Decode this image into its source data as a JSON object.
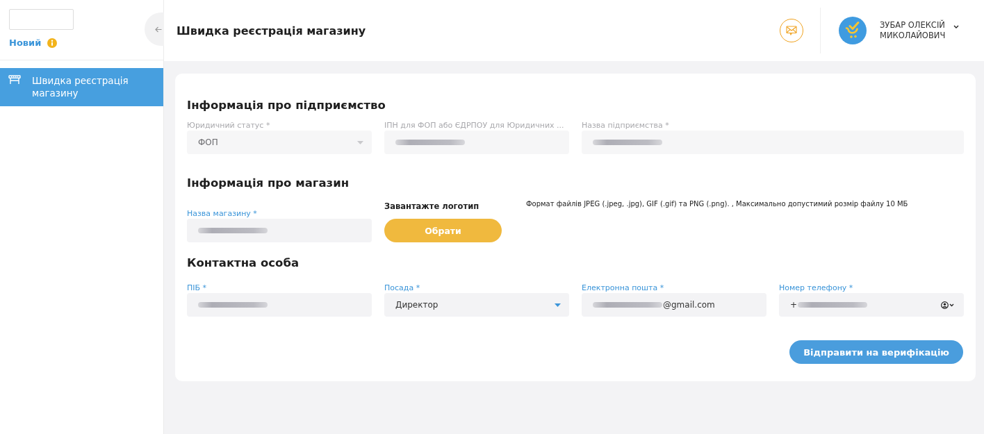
{
  "sidebar": {
    "status": "Новий",
    "nav_items": [
      {
        "label": "Швидка реєстрація магазину",
        "selected": true
      }
    ]
  },
  "header": {
    "title": "Швидка реєстрація магазину",
    "user_name": "ЗУБАР ОЛЕКСІЙ МИКОЛАЙОВИЧ"
  },
  "sections": [
    {
      "title": "Інформація про підприємство",
      "fields": [
        {
          "kind": "select",
          "label": "Юридичний статус *",
          "parts": [
            {
              "kind": "text",
              "text": "ФОП"
            }
          ],
          "disabled": true
        },
        {
          "kind": "text",
          "label": "ІПН для ФОП або ЄДРПОУ для Юридичних ...",
          "parts": [
            {
              "kind": "blurred"
            }
          ],
          "disabled": true
        },
        {
          "kind": "text",
          "label": "Назва підприємства *",
          "parts": [
            {
              "kind": "blurred"
            }
          ],
          "disabled": true
        }
      ]
    },
    {
      "title": "Інформація про магазин",
      "fields": [
        {
          "kind": "text",
          "label": "Назва магазину *",
          "parts": [
            {
              "kind": "blurred"
            }
          ],
          "disabled": false
        },
        {
          "kind": "upload",
          "label": "Завантажте логотип",
          "button": "Обрати",
          "note": "Формат файлів JPEG (.jpeg, .jpg), GIF (.gif) та PNG (.png). , Максимально допустимий розмір файлу 10 МБ"
        }
      ]
    },
    {
      "title": "Контактна особа",
      "fields": [
        {
          "kind": "text",
          "label": "ПІБ *",
          "parts": [
            {
              "kind": "blurred"
            }
          ],
          "disabled": false
        },
        {
          "kind": "select",
          "label": "Посада *",
          "parts": [
            {
              "kind": "text",
              "text": "Директор"
            }
          ],
          "disabled": false
        },
        {
          "kind": "text",
          "label": "Електронна пошта *",
          "parts": [
            {
              "kind": "blurred"
            },
            {
              "kind": "text",
              "text": "@gmail.com"
            }
          ],
          "disabled": false
        },
        {
          "kind": "phone",
          "label": "Номер телефону *",
          "parts": [
            {
              "kind": "text",
              "text": "+"
            },
            {
              "kind": "blurred"
            }
          ],
          "disabled": false
        }
      ]
    }
  ],
  "submit_button": "Відправити на верифікацію"
}
